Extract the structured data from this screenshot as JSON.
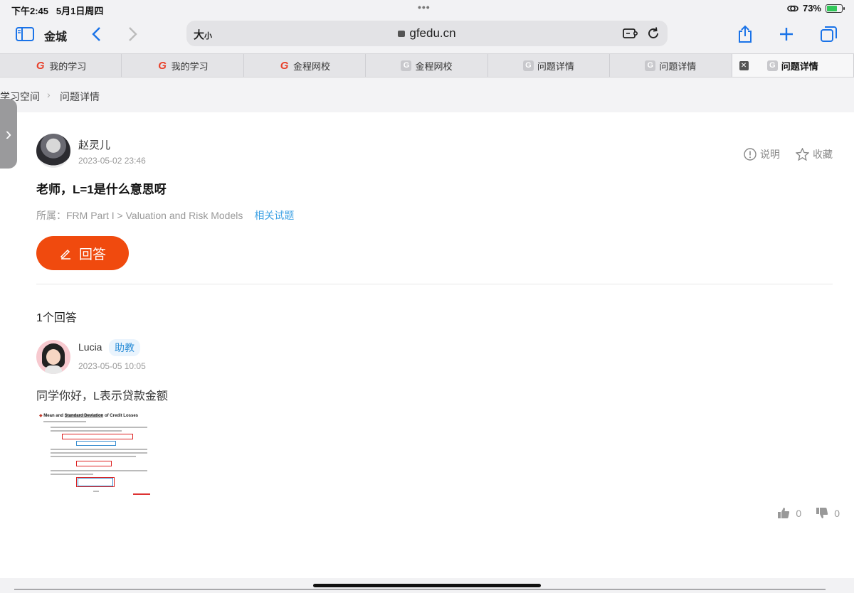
{
  "status": {
    "time": "下午2:45",
    "date": "5月1日周四",
    "battery": "73%",
    "battery_level_pct": 73
  },
  "browser": {
    "title": "金城",
    "size_label": "大",
    "size_label_small": "小",
    "url": "gfedu.cn",
    "icons": [
      "sidebar-icon",
      "back-icon",
      "forward-icon",
      "share-icon",
      "add-icon",
      "tabs-icon",
      "extension-icon",
      "reload-icon",
      "lock-icon"
    ]
  },
  "tabs": [
    {
      "label": "我的学习",
      "fav": "G"
    },
    {
      "label": "我的学习",
      "fav": "G"
    },
    {
      "label": "金程网校",
      "fav": "G"
    },
    {
      "label": "金程网校",
      "fav": "G"
    },
    {
      "label": "问题详情",
      "fav": "G"
    },
    {
      "label": "问题详情",
      "fav": "G"
    },
    {
      "label": "问题详情",
      "fav": "G",
      "active": true
    }
  ],
  "breadcrumb": {
    "parent": "学习空间",
    "sep": "›",
    "current": "问题详情"
  },
  "question": {
    "author": "赵灵儿",
    "date": "2023-05-02 23:46",
    "explain_label": "说明",
    "favorite_label": "收藏",
    "title": "老师，L=1是什么意思呀",
    "meta": "所属：FRM Part I > Valuation and Risk Models",
    "related_label": "相关试题",
    "answer_button": "回答"
  },
  "answers": {
    "count_label": "1个回答",
    "items": [
      {
        "author": "Lucia",
        "badge": "助教",
        "date": "2023-05-05 10:05",
        "text": "同学你好，L表示贷款金额",
        "image_title_parts": [
          "Mean and ",
          "Standard Deviation",
          " of Credit Losses"
        ],
        "likes": "0",
        "dislikes": "0"
      }
    ]
  },
  "colors": {
    "accent": "#1a73e8",
    "answer_button": "#f04a0e",
    "link": "#3fa2e4",
    "badge_bg": "#eaf4fd"
  }
}
